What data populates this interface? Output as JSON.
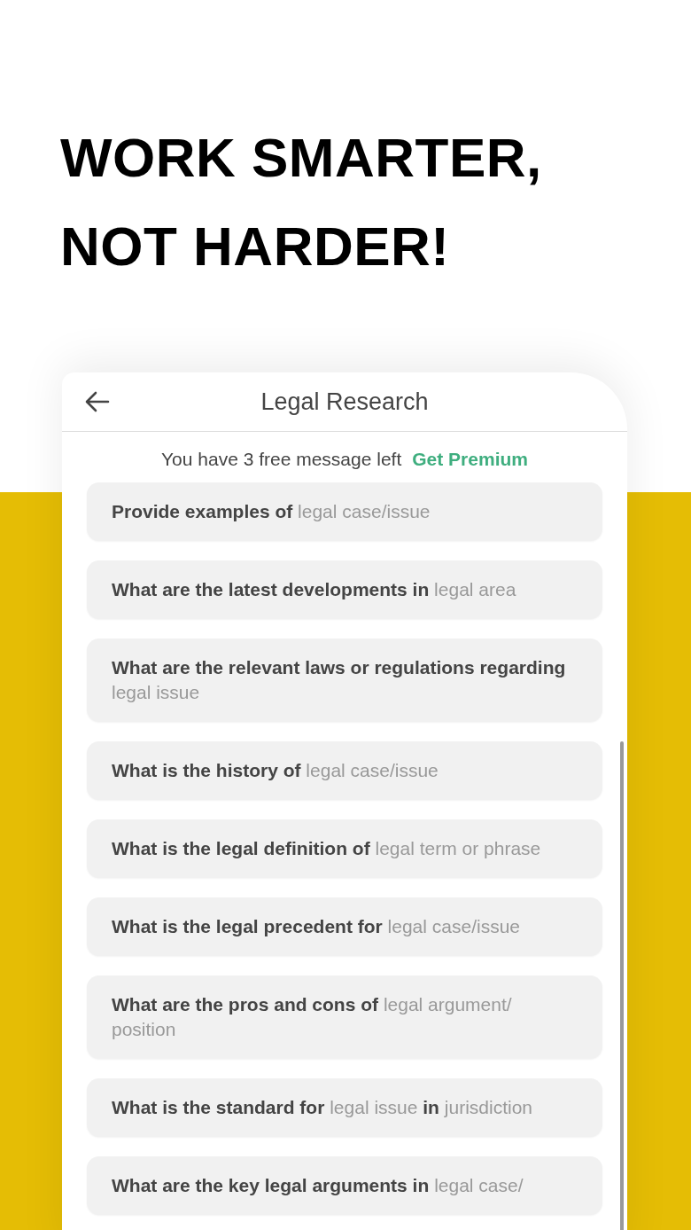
{
  "headline": [
    "WORK SMARTER,",
    "NOT HARDER!"
  ],
  "screen": {
    "title": "Legal Research",
    "notice": {
      "text": "You have 3 free message left",
      "link": "Get Premium"
    },
    "prompts": [
      {
        "parts": [
          {
            "kind": "bold",
            "text": "Provide examples of"
          },
          {
            "kind": "hint",
            "text": "legal case/issue"
          }
        ]
      },
      {
        "parts": [
          {
            "kind": "bold",
            "text": "What are the latest developments in"
          },
          {
            "kind": "hint",
            "text": "legal area"
          }
        ]
      },
      {
        "parts": [
          {
            "kind": "bold",
            "text": "What are the relevant laws or regulations regarding"
          },
          {
            "kind": "hint",
            "text": "legal issue"
          }
        ]
      },
      {
        "parts": [
          {
            "kind": "bold",
            "text": "What is the history of"
          },
          {
            "kind": "hint",
            "text": "legal case/issue"
          }
        ]
      },
      {
        "parts": [
          {
            "kind": "bold",
            "text": "What is the legal definition of"
          },
          {
            "kind": "hint",
            "text": "legal term or phrase"
          }
        ]
      },
      {
        "parts": [
          {
            "kind": "bold",
            "text": "What is the legal precedent for"
          },
          {
            "kind": "hint",
            "text": "legal case/issue"
          }
        ]
      },
      {
        "parts": [
          {
            "kind": "bold",
            "text": "What are the pros and cons of"
          },
          {
            "kind": "hint",
            "text": "legal argument/ position"
          }
        ]
      },
      {
        "parts": [
          {
            "kind": "bold",
            "text": "What is the standard for"
          },
          {
            "kind": "hint",
            "text": "legal issue"
          },
          {
            "kind": "bold",
            "text": "in"
          },
          {
            "kind": "hint",
            "text": "jurisdiction"
          }
        ]
      },
      {
        "parts": [
          {
            "kind": "bold",
            "text": "What are the key legal arguments in"
          },
          {
            "kind": "hint",
            "text": "legal case/"
          }
        ]
      }
    ]
  }
}
